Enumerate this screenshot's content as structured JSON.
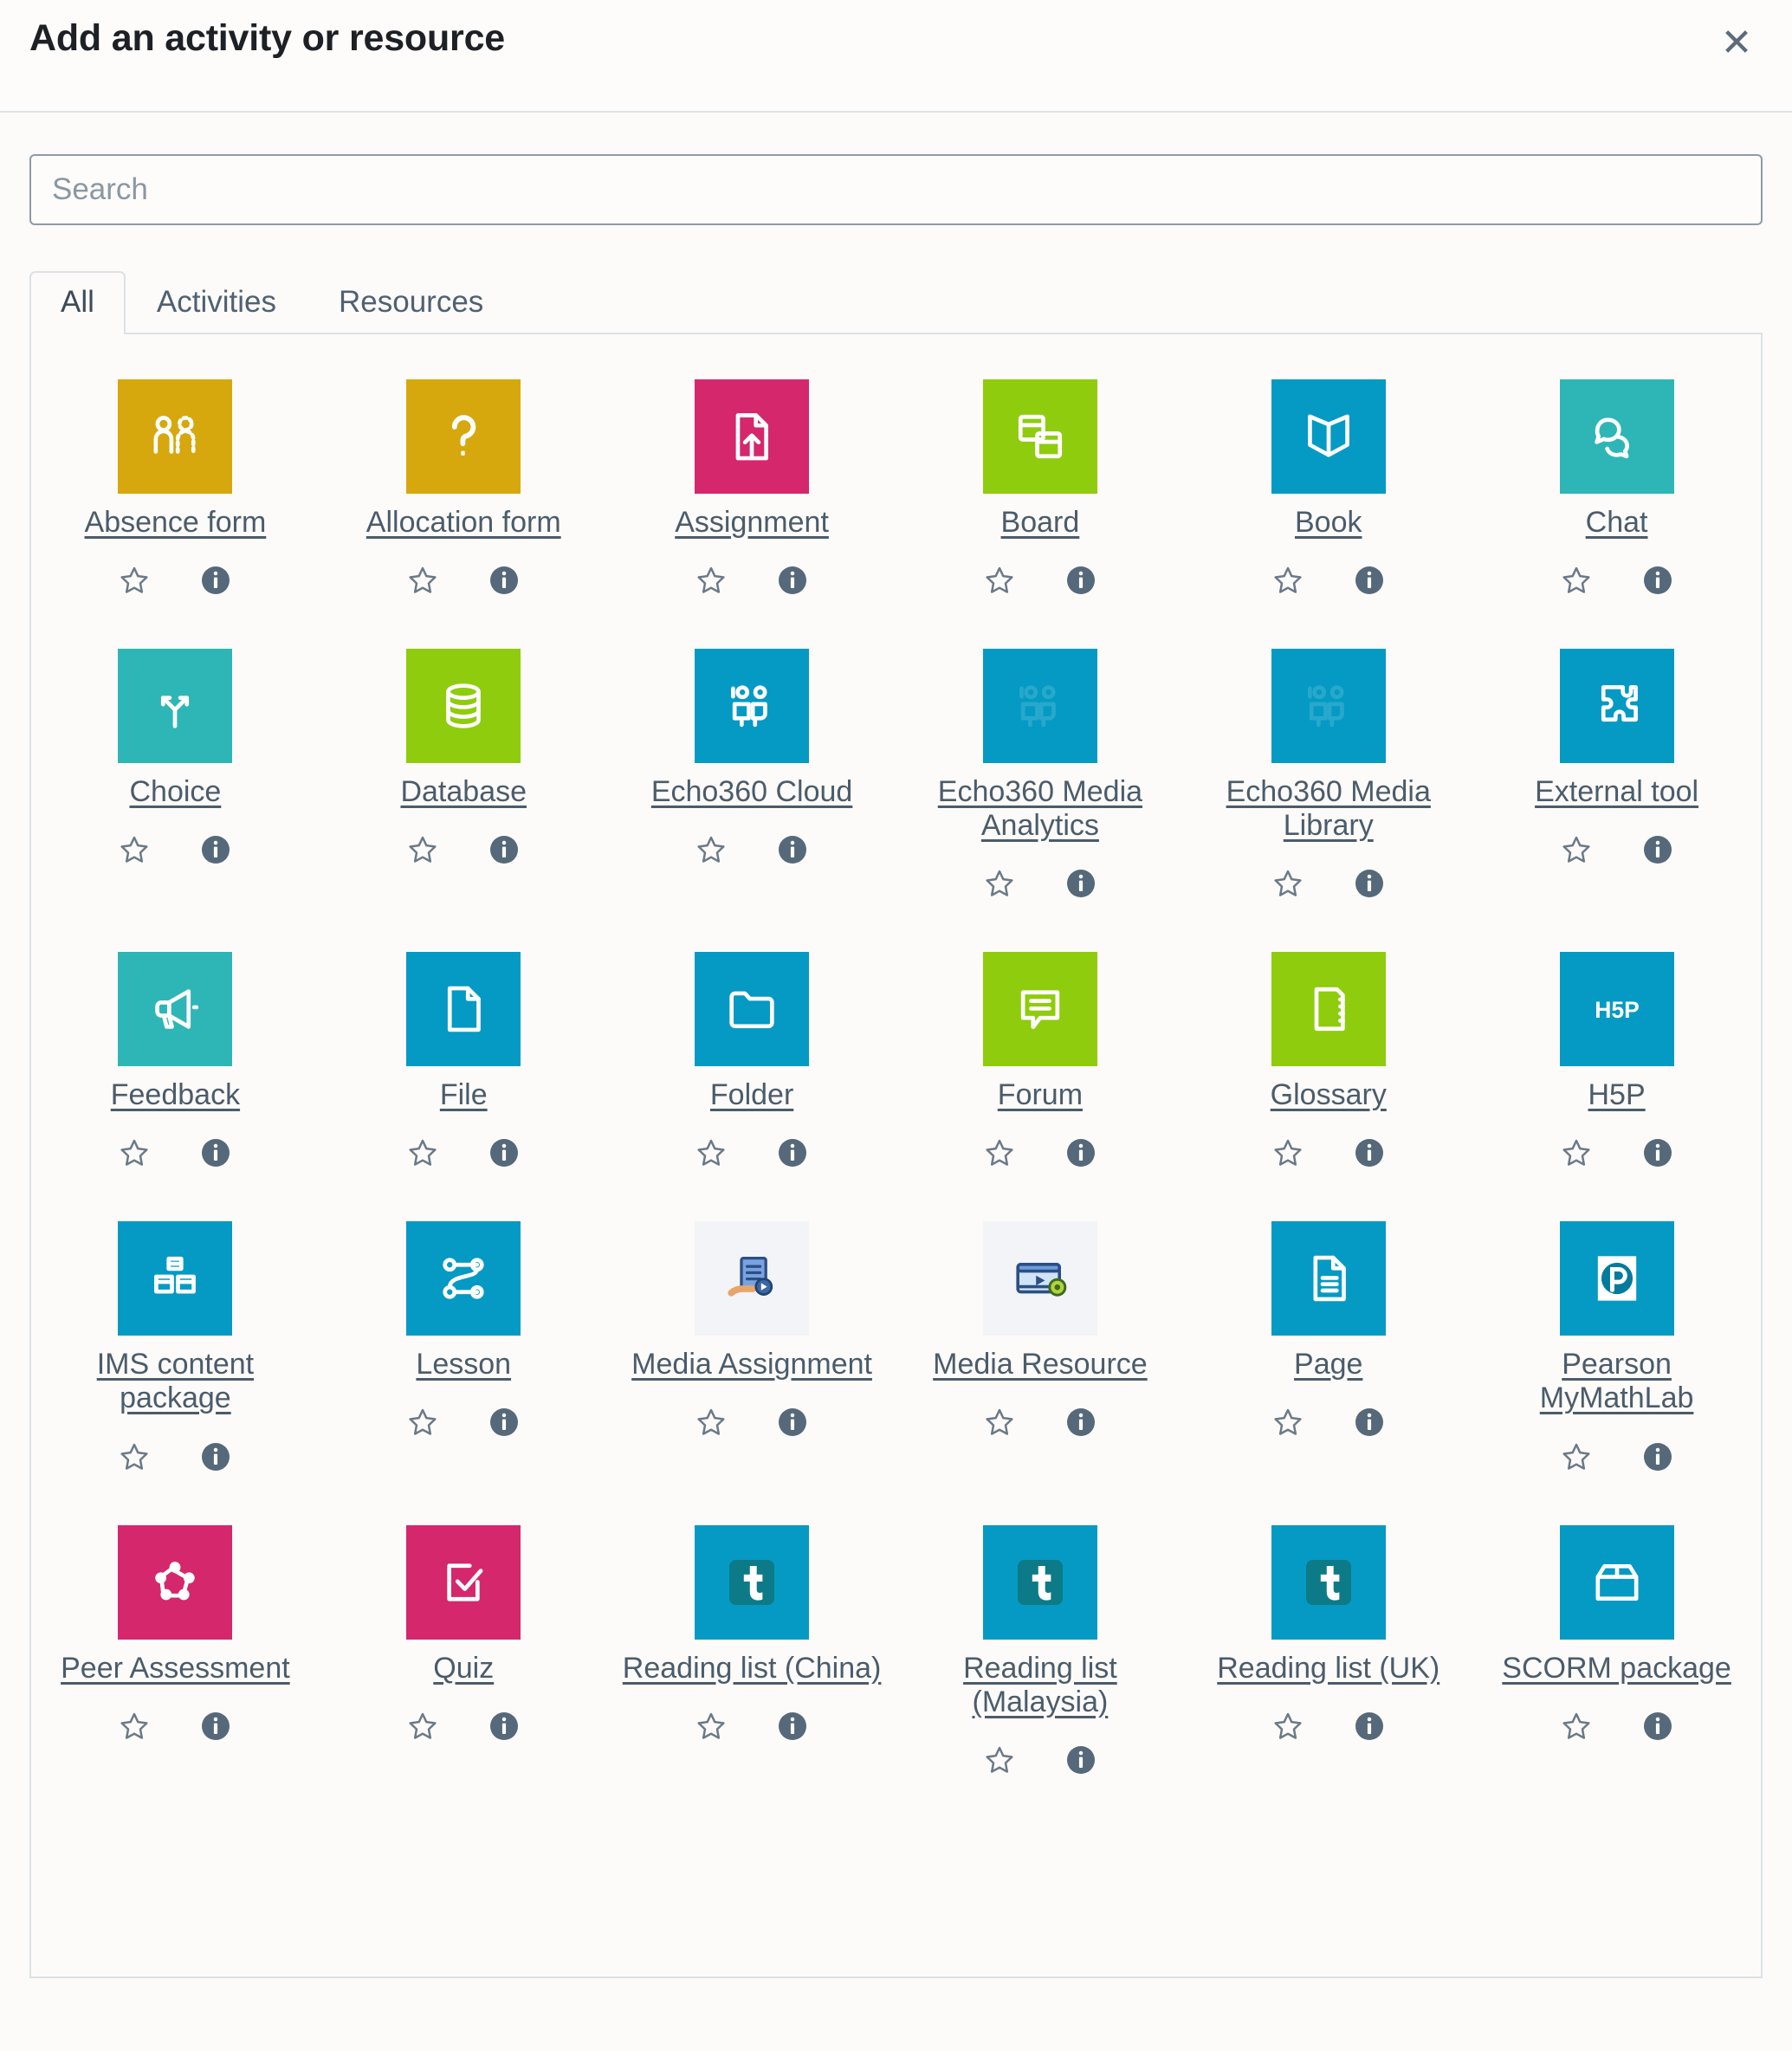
{
  "header": {
    "title": "Add an activity or resource",
    "close_label": "✕"
  },
  "search": {
    "placeholder": "Search",
    "value": ""
  },
  "tabs": [
    {
      "label": "All",
      "active": true
    },
    {
      "label": "Activities",
      "active": false
    },
    {
      "label": "Resources",
      "active": false
    }
  ],
  "actions": {
    "favourite_label": "star-outline",
    "info_label": "info-circle"
  },
  "colors": {
    "gold": "#d6a80e",
    "pink": "#d5276c",
    "green": "#8fcc0d",
    "blue": "#049ac4",
    "teal": "#2eb6b6",
    "light": "#f2f4f7",
    "text": "#4b5c6b"
  },
  "items": [
    {
      "label": "Absence form",
      "icon": "people-dotted-icon",
      "color": "gold",
      "faded": false
    },
    {
      "label": "Allocation form",
      "icon": "question-mark-icon",
      "color": "gold",
      "faded": false
    },
    {
      "label": "Assignment",
      "icon": "file-upload-icon",
      "color": "pink",
      "faded": false
    },
    {
      "label": "Board",
      "icon": "panels-icon",
      "color": "green",
      "faded": false
    },
    {
      "label": "Book",
      "icon": "open-book-icon",
      "color": "blue",
      "faded": false
    },
    {
      "label": "Chat",
      "icon": "speech-bubbles-icon",
      "color": "teal",
      "faded": false
    },
    {
      "label": "Choice",
      "icon": "fork-arrows-icon",
      "color": "teal",
      "faded": false
    },
    {
      "label": "Database",
      "icon": "database-icon",
      "color": "green",
      "faded": false
    },
    {
      "label": "Echo360 Cloud",
      "icon": "two-people-icon",
      "color": "blue",
      "faded": false
    },
    {
      "label": "Echo360 Media Analytics",
      "icon": "two-people-icon",
      "color": "blue",
      "faded": true
    },
    {
      "label": "Echo360 Media Library",
      "icon": "two-people-icon",
      "color": "blue",
      "faded": true
    },
    {
      "label": "External tool",
      "icon": "puzzle-piece-icon",
      "color": "blue",
      "faded": false
    },
    {
      "label": "Feedback",
      "icon": "megaphone-icon",
      "color": "teal",
      "faded": false
    },
    {
      "label": "File",
      "icon": "document-icon",
      "color": "blue",
      "faded": false
    },
    {
      "label": "Folder",
      "icon": "folder-icon",
      "color": "blue",
      "faded": false
    },
    {
      "label": "Forum",
      "icon": "comment-lines-icon",
      "color": "green",
      "faded": false
    },
    {
      "label": "Glossary",
      "icon": "notebook-icon",
      "color": "green",
      "faded": false
    },
    {
      "label": "H5P",
      "icon": "h5p-logo-icon",
      "color": "blue",
      "faded": false
    },
    {
      "label": "IMS content package",
      "icon": "boxes-icon",
      "color": "blue",
      "faded": false
    },
    {
      "label": "Lesson",
      "icon": "path-nodes-icon",
      "color": "blue",
      "faded": false
    },
    {
      "label": "Media Assignment",
      "icon": "hand-document-play-icon",
      "color": "light",
      "faded": false
    },
    {
      "label": "Media Resource",
      "icon": "video-player-icon",
      "color": "light",
      "faded": false
    },
    {
      "label": "Page",
      "icon": "page-lines-icon",
      "color": "blue",
      "faded": false
    },
    {
      "label": "Pearson MyMathLab",
      "icon": "pearson-p-icon",
      "color": "blue",
      "faded": false
    },
    {
      "label": "Peer Assessment",
      "icon": "network-dots-icon",
      "color": "pink",
      "faded": false
    },
    {
      "label": "Quiz",
      "icon": "checkbox-pencil-icon",
      "color": "pink",
      "faded": false
    },
    {
      "label": "Reading list (China)",
      "icon": "talis-t-icon",
      "color": "blue",
      "faded": false
    },
    {
      "label": "Reading list (Malaysia)",
      "icon": "talis-t-icon",
      "color": "blue",
      "faded": false
    },
    {
      "label": "Reading list (UK)",
      "icon": "talis-t-icon",
      "color": "blue",
      "faded": false
    },
    {
      "label": "SCORM package",
      "icon": "open-box-icon",
      "color": "blue",
      "faded": false
    }
  ]
}
